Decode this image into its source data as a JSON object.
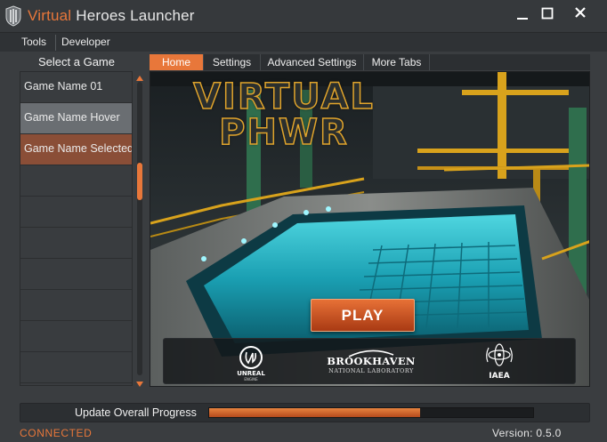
{
  "window": {
    "title_accent": "Virtual",
    "title_rest": "Heroes Launcher",
    "logo_icon": "shield-logo-icon",
    "controls": [
      "minimize-icon",
      "maximize-icon",
      "close-icon"
    ]
  },
  "menu": {
    "items": [
      {
        "label": "Tools"
      },
      {
        "label": "Developer"
      }
    ]
  },
  "sidebar": {
    "title": "Select a Game",
    "games": [
      {
        "label": "Game Name 01",
        "state": "normal"
      },
      {
        "label": "Game Name Hover",
        "state": "hover"
      },
      {
        "label": "Game Name Selected",
        "state": "selected"
      },
      {
        "label": "",
        "state": "empty"
      },
      {
        "label": "",
        "state": "empty"
      },
      {
        "label": "",
        "state": "empty"
      },
      {
        "label": "",
        "state": "empty"
      },
      {
        "label": "",
        "state": "empty"
      },
      {
        "label": "",
        "state": "empty"
      },
      {
        "label": "",
        "state": "empty"
      }
    ],
    "scroll_position": 0.3
  },
  "tabs": [
    {
      "label": "Home",
      "active": true
    },
    {
      "label": "Settings",
      "active": false
    },
    {
      "label": "Advanced Settings",
      "active": false
    },
    {
      "label": "More Tabs",
      "active": false
    }
  ],
  "home": {
    "hero_title_line1": "VIRTUAL",
    "hero_title_line2": "PHWR",
    "play_label": "PLAY",
    "logos": {
      "unreal": "UNREAL",
      "unreal_sub": "ENGINE",
      "brookhaven": "BROOKHAVEN",
      "brookhaven_sub": "NATIONAL LABORATORY",
      "iaea": "IAEA"
    }
  },
  "progress": {
    "label": "Update Overall Progress",
    "fraction": 0.65
  },
  "status": {
    "connection": "CONNECTED",
    "version": "Version: 0.5.0"
  },
  "colors": {
    "accent": "#e8773a",
    "background": "#3a3d40",
    "selected_item": "#8a4e37",
    "hover_item": "#6a6e72",
    "pool_water": "#1fa8b8"
  }
}
